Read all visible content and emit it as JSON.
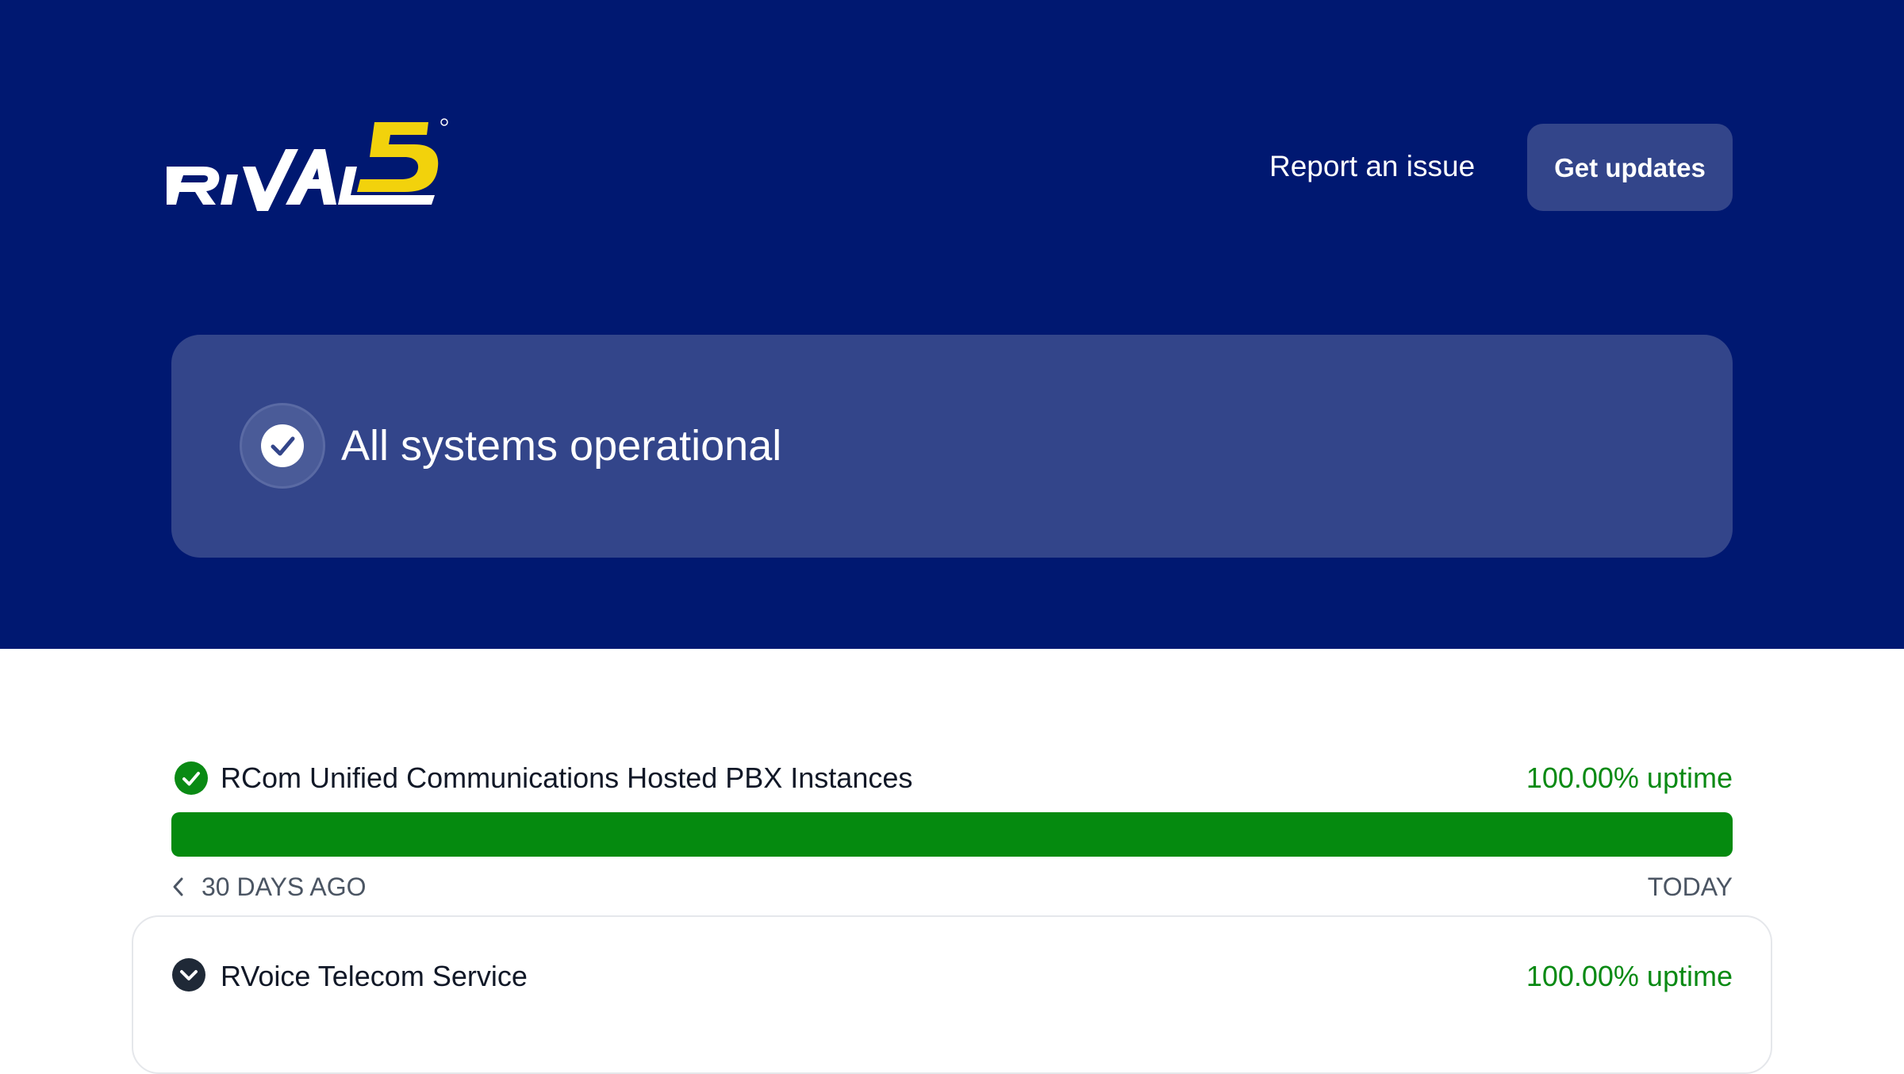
{
  "brand": {
    "logo_text": "RIVAL",
    "logo_mark": "5",
    "colors": {
      "hero_bg": "#001871",
      "card_bg": "#33458a",
      "logo_yellow": "#f2d20c",
      "success": "#0a8a14"
    }
  },
  "header": {
    "report_link": "Report an issue",
    "updates_button": "Get updates"
  },
  "status": {
    "icon": "check-circle-icon",
    "message": "All systems operational"
  },
  "components": [
    {
      "name": "RCom Unified Communications Hosted PBX Instances",
      "uptime": "100.00% uptime",
      "uptime_fraction": 1.0,
      "icon": "check-circle-icon",
      "range_start": "30 DAYS AGO",
      "range_end": "TODAY"
    },
    {
      "name": "RVoice Telecom Service",
      "uptime": "100.00% uptime",
      "icon": "chevron-down-icon"
    }
  ]
}
